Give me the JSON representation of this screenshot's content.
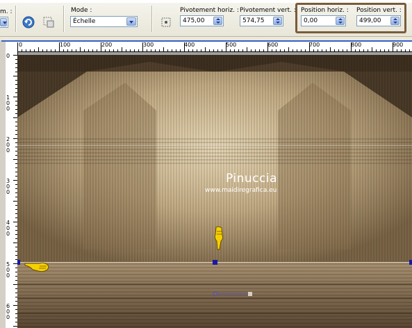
{
  "toolbar": {
    "partial_label": "m. :",
    "mode_label": "Mode :",
    "mode_value": "Échelle",
    "pivot_h_label": "Pivotement horiz. :",
    "pivot_h_value": "475,00",
    "pivot_v_label": "Pivotement vert. :",
    "pivot_v_value": "574,75",
    "pos_h_label": "Position horiz. :",
    "pos_h_value": "0,00",
    "pos_v_label": "Position vert. :",
    "pos_v_value": "499,00"
  },
  "ruler": {
    "h_labels": [
      "0",
      "100",
      "200",
      "300",
      "400",
      "500",
      "600",
      "700",
      "800",
      "900"
    ],
    "v_labels": [
      "0",
      "100",
      "200",
      "300",
      "400",
      "500",
      "600"
    ]
  },
  "canvas": {
    "watermark_title": "Pinuccia",
    "watermark_url": "www.maidiregrafica.eu"
  },
  "colors": {
    "highlight_border": "#7a5c3a",
    "image_base": "#b69e78",
    "image_dark": "#4a3a28",
    "handle_color": "#1a1aa0"
  },
  "icons": [
    "refresh-icon",
    "transform-icon",
    "pivot-icon",
    "pointing-hand-icon",
    "pointing-down-hand-icon"
  ]
}
